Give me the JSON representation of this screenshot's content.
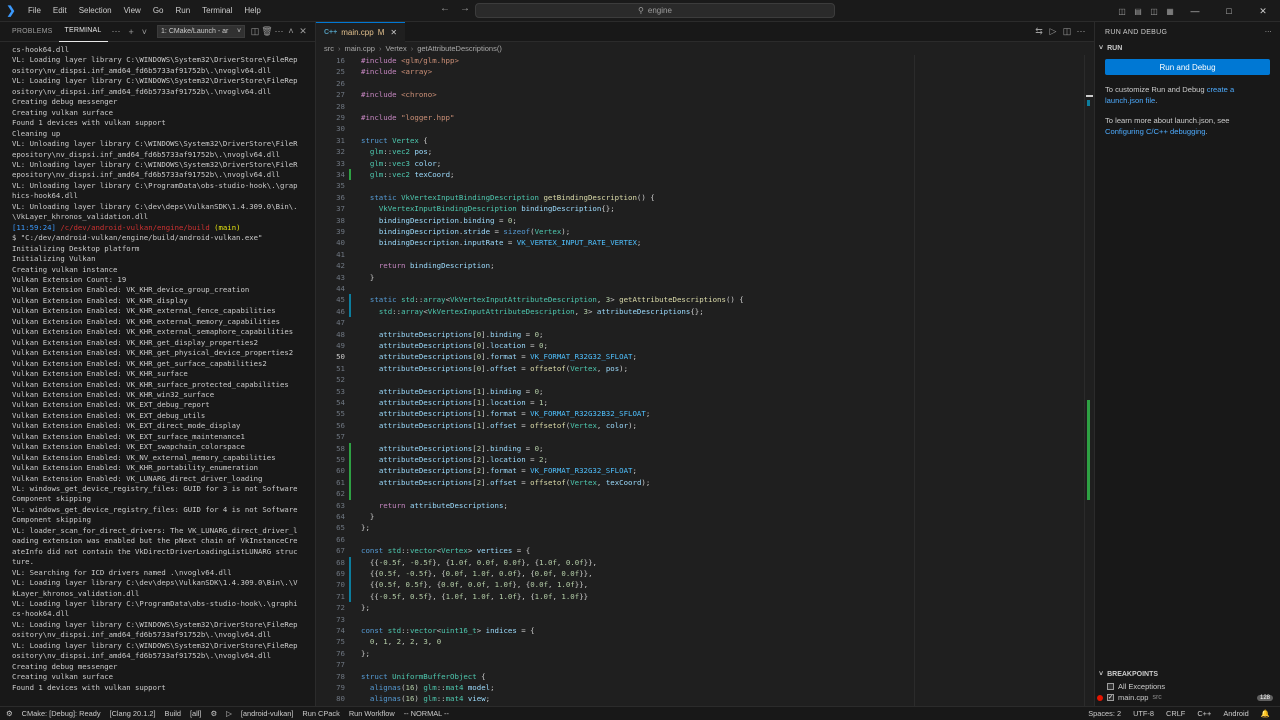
{
  "titlebar": {
    "menu": [
      "File",
      "Edit",
      "Selection",
      "View",
      "Go",
      "Run",
      "Terminal",
      "Help"
    ],
    "search_text": "engine",
    "icons": [
      "vscode-logo",
      "back-arrow",
      "forward-arrow",
      "search-icon",
      "toggle-primary-sidebar",
      "toggle-panel",
      "toggle-secondary-sidebar",
      "customize-layout",
      "minimize",
      "maximize",
      "close"
    ]
  },
  "panel": {
    "tab_problems": "PROBLEMS",
    "tab_terminal": "TERMINAL",
    "terminal_select": "1: CMake/Launch - ar",
    "lines": [
      "cs-hook64.dll",
      "VL: Loading layer library C:\\WINDOWS\\System32\\DriverStore\\FileRep",
      "ository\\nv_dispsi.inf_amd64_fd6b5733af91752b\\.\\nvoglv64.dll",
      "VL: Loading layer library C:\\WINDOWS\\System32\\DriverStore\\FileRep",
      "ository\\nv_dispsi.inf_amd64_fd6b5733af91752b\\.\\nvoglv64.dll",
      "Creating debug messenger",
      "Creating vulkan surface",
      "Found 1 devices with vulkan support",
      "Cleaning up",
      "VL: Unloading layer library C:\\WINDOWS\\System32\\DriverStore\\FileR",
      "epository\\nv_dispsi.inf_amd64_fd6b5733af91752b\\.\\nvoglv64.dll",
      "VL: Unloading layer library C:\\WINDOWS\\System32\\DriverStore\\FileR",
      "epository\\nv_dispsi.inf_amd64_fd6b5733af91752b\\.\\nvoglv64.dll",
      "VL: Unloading layer library C:\\ProgramData\\obs-studio-hook\\.\\grap",
      "hics-hook64.dll",
      "VL: Unloading layer library C:\\dev\\deps\\VulkanSDK\\1.4.309.0\\Bin\\.",
      "\\VkLayer_khronos_validation.dll"
    ],
    "prompt_time": "[11:59:24]",
    "prompt_path": "/c/dev/android-vulkan/engine/build",
    "prompt_branch": "(main)",
    "lines_after": [
      "$ \"C:/dev/android-vulkan/engine/build/android-vulkan.exe\"",
      "Initializing Desktop platform",
      "Initializing Vulkan",
      "Creating vulkan instance",
      "Vulkan Extension Count: 19",
      "Vulkan Extension Enabled: VK_KHR_device_group_creation",
      "Vulkan Extension Enabled: VK_KHR_display",
      "Vulkan Extension Enabled: VK_KHR_external_fence_capabilities",
      "Vulkan Extension Enabled: VK_KHR_external_memory_capabilities",
      "Vulkan Extension Enabled: VK_KHR_external_semaphore_capabilities",
      "Vulkan Extension Enabled: VK_KHR_get_display_properties2",
      "Vulkan Extension Enabled: VK_KHR_get_physical_device_properties2",
      "Vulkan Extension Enabled: VK_KHR_get_surface_capabilities2",
      "Vulkan Extension Enabled: VK_KHR_surface",
      "Vulkan Extension Enabled: VK_KHR_surface_protected_capabilities",
      "Vulkan Extension Enabled: VK_KHR_win32_surface",
      "Vulkan Extension Enabled: VK_EXT_debug_report",
      "Vulkan Extension Enabled: VK_EXT_debug_utils",
      "Vulkan Extension Enabled: VK_EXT_direct_mode_display",
      "Vulkan Extension Enabled: VK_EXT_surface_maintenance1",
      "Vulkan Extension Enabled: VK_EXT_swapchain_colorspace",
      "Vulkan Extension Enabled: VK_NV_external_memory_capabilities",
      "Vulkan Extension Enabled: VK_KHR_portability_enumeration",
      "Vulkan Extension Enabled: VK_LUNARG_direct_driver_loading",
      "VL: windows_get_device_registry_files: GUID for 3 is not Software",
      "Component skipping",
      "VL: windows_get_device_registry_files: GUID for 4 is not Software",
      "Component skipping",
      "VL: loader_scan_for_direct_drivers: The VK_LUNARG_direct_driver_l",
      "oading extension was enabled but the pNext chain of VkInstanceCre",
      "ateInfo did not contain the VkDirectDriverLoadingListLUNARG struc",
      "ture.",
      "VL: Searching for ICD drivers named .\\nvoglv64.dll",
      "VL: Loading layer library C:\\dev\\deps\\VulkanSDK\\1.4.309.0\\Bin\\.\\V",
      "kLayer_khronos_validation.dll",
      "VL: Loading layer library C:\\ProgramData\\obs-studio-hook\\.\\graphi",
      "cs-hook64.dll",
      "VL: Loading layer library C:\\WINDOWS\\System32\\DriverStore\\FileRep",
      "ository\\nv_dispsi.inf_amd64_fd6b5733af91752b\\.\\nvoglv64.dll",
      "VL: Loading layer library C:\\WINDOWS\\System32\\DriverStore\\FileRep",
      "ository\\nv_dispsi.inf_amd64_fd6b5733af91752b\\.\\nvoglv64.dll",
      "Creating debug messenger",
      "Creating vulkan surface",
      "Found 1 devices with vulkan support",
      ""
    ]
  },
  "editor": {
    "tab_lang": "C++",
    "tab_name": "main.cpp",
    "tab_state": "M",
    "breadcrumb": [
      "src",
      "main.cpp",
      "Vertex",
      "getAttributeDescriptions()"
    ],
    "current_line": "50",
    "lines": [
      {
        "n": "16",
        "g": "",
        "h": "<span class='pp'>#include</span> <span class='st'>&lt;glm/glm.hpp&gt;</span>"
      },
      {
        "n": "25",
        "g": "",
        "h": "<span class='pp'>#include</span> <span class='st'>&lt;array&gt;</span>"
      },
      {
        "n": "26",
        "g": "",
        "h": ""
      },
      {
        "n": "27",
        "g": "",
        "h": "<span class='pp'>#include</span> <span class='st'>&lt;chrono&gt;</span>"
      },
      {
        "n": "28",
        "g": "",
        "h": ""
      },
      {
        "n": "29",
        "g": "",
        "h": "<span class='pp'>#include</span> <span class='st'>\"logger.hpp\"</span>"
      },
      {
        "n": "30",
        "g": "",
        "h": ""
      },
      {
        "n": "31",
        "g": "",
        "h": "<span class='kw'>struct</span> <span class='ty'>Vertex</span> {"
      },
      {
        "n": "32",
        "g": "",
        "h": "  <span class='ty'>glm</span>::<span class='ty'>vec2</span> <span class='vr'>pos</span>;"
      },
      {
        "n": "33",
        "g": "",
        "h": "  <span class='ty'>glm</span>::<span class='ty'>vec3</span> <span class='vr'>color</span>;"
      },
      {
        "n": "34",
        "g": "add",
        "h": "  <span class='ty'>glm</span>::<span class='ty'>vec2</span> <span class='vr'>texCoord</span>;"
      },
      {
        "n": "35",
        "g": "",
        "h": ""
      },
      {
        "n": "36",
        "g": "",
        "h": "  <span class='kw'>static</span> <span class='ty'>VkVertexInputBindingDescription</span> <span class='fn'>getBindingDescription</span>() {"
      },
      {
        "n": "37",
        "g": "",
        "h": "    <span class='ty'>VkVertexInputBindingDescription</span> <span class='vr'>bindingDescription</span>{};"
      },
      {
        "n": "38",
        "g": "",
        "h": "    <span class='vr'>bindingDescription</span>.<span class='vr'>binding</span> = <span class='nu'>0</span>;"
      },
      {
        "n": "39",
        "g": "",
        "h": "    <span class='vr'>bindingDescription</span>.<span class='vr'>stride</span> = <span class='kw'>sizeof</span>(<span class='ty'>Vertex</span>);"
      },
      {
        "n": "40",
        "g": "",
        "h": "    <span class='vr'>bindingDescription</span>.<span class='vr'>inputRate</span> = <span class='en'>VK_VERTEX_INPUT_RATE_VERTEX</span>;"
      },
      {
        "n": "41",
        "g": "",
        "h": ""
      },
      {
        "n": "42",
        "g": "",
        "h": "    <span class='pp'>return</span> <span class='vr'>bindingDescription</span>;"
      },
      {
        "n": "43",
        "g": "",
        "h": "  }"
      },
      {
        "n": "44",
        "g": "",
        "h": ""
      },
      {
        "n": "45",
        "g": "mod",
        "h": "  <span class='kw'>static</span> <span class='ty'>std</span>::<span class='ty'>array</span>&lt;<span class='ty'>VkVertexInputAttributeDescription</span>, <span class='nu'>3</span>&gt; <span class='fn'>getAttributeDescriptions</span>() {"
      },
      {
        "n": "46",
        "g": "mod",
        "h": "    <span class='ty'>std</span>::<span class='ty'>array</span>&lt;<span class='ty'>VkVertexInputAttributeDescription</span>, <span class='nu'>3</span>&gt; <span class='vr'>attributeDescriptions</span>{};"
      },
      {
        "n": "47",
        "g": "",
        "h": ""
      },
      {
        "n": "48",
        "g": "",
        "h": "    <span class='vr'>attributeDescriptions</span>[<span class='nu'>0</span>].<span class='vr'>binding</span> = <span class='nu'>0</span>;"
      },
      {
        "n": "49",
        "g": "",
        "h": "    <span class='vr'>attributeDescriptions</span>[<span class='nu'>0</span>].<span class='vr'>location</span> = <span class='nu'>0</span>;"
      },
      {
        "n": "50",
        "g": "",
        "h": "    <span class='vr'>attributeDescriptions</span>[<span class='nu'>0</span>].<span class='vr'>format</span> = <span class='en'>VK_FORMAT_R32G32_SFLOAT</span>;"
      },
      {
        "n": "51",
        "g": "",
        "h": "    <span class='vr'>attributeDescriptions</span>[<span class='nu'>0</span>].<span class='vr'>offset</span> = <span class='fn'>offsetof</span>(<span class='ty'>Vertex</span>, <span class='vr'>pos</span>);"
      },
      {
        "n": "52",
        "g": "",
        "h": ""
      },
      {
        "n": "53",
        "g": "",
        "h": "    <span class='vr'>attributeDescriptions</span>[<span class='nu'>1</span>].<span class='vr'>binding</span> = <span class='nu'>0</span>;"
      },
      {
        "n": "54",
        "g": "",
        "h": "    <span class='vr'>attributeDescriptions</span>[<span class='nu'>1</span>].<span class='vr'>location</span> = <span class='nu'>1</span>;"
      },
      {
        "n": "55",
        "g": "",
        "h": "    <span class='vr'>attributeDescriptions</span>[<span class='nu'>1</span>].<span class='vr'>format</span> = <span class='en'>VK_FORMAT_R32G32B32_SFLOAT</span>;"
      },
      {
        "n": "56",
        "g": "",
        "h": "    <span class='vr'>attributeDescriptions</span>[<span class='nu'>1</span>].<span class='vr'>offset</span> = <span class='fn'>offsetof</span>(<span class='ty'>Vertex</span>, <span class='vr'>color</span>);"
      },
      {
        "n": "57",
        "g": "",
        "h": ""
      },
      {
        "n": "58",
        "g": "add",
        "h": "    <span class='vr'>attributeDescriptions</span>[<span class='nu'>2</span>].<span class='vr'>binding</span> = <span class='nu'>0</span>;"
      },
      {
        "n": "59",
        "g": "add",
        "h": "    <span class='vr'>attributeDescriptions</span>[<span class='nu'>2</span>].<span class='vr'>location</span> = <span class='nu'>2</span>;"
      },
      {
        "n": "60",
        "g": "add",
        "h": "    <span class='vr'>attributeDescriptions</span>[<span class='nu'>2</span>].<span class='vr'>format</span> = <span class='en'>VK_FORMAT_R32G32_SFLOAT</span>;"
      },
      {
        "n": "61",
        "g": "add",
        "h": "    <span class='vr'>attributeDescriptions</span>[<span class='nu'>2</span>].<span class='vr'>offset</span> = <span class='fn'>offsetof</span>(<span class='ty'>Vertex</span>, <span class='vr'>texCoord</span>);"
      },
      {
        "n": "62",
        "g": "add",
        "h": ""
      },
      {
        "n": "63",
        "g": "",
        "h": "    <span class='pp'>return</span> <span class='vr'>attributeDescriptions</span>;"
      },
      {
        "n": "64",
        "g": "",
        "h": "  }"
      },
      {
        "n": "65",
        "g": "",
        "h": "};"
      },
      {
        "n": "66",
        "g": "",
        "h": ""
      },
      {
        "n": "67",
        "g": "",
        "h": "<span class='kw'>const</span> <span class='ty'>std</span>::<span class='ty'>vector</span>&lt;<span class='ty'>Vertex</span>&gt; <span class='vr'>vertices</span> = {"
      },
      {
        "n": "68",
        "g": "mod",
        "h": "  {{<span class='nu'>-0.5f</span>, <span class='nu'>-0.5f</span>}, {<span class='nu'>1.0f</span>, <span class='nu'>0.0f</span>, <span class='nu'>0.0f</span>}, {<span class='nu'>1.0f</span>, <span class='nu'>0.0f</span>}},"
      },
      {
        "n": "69",
        "g": "mod",
        "h": "  {{<span class='nu'>0.5f</span>, <span class='nu'>-0.5f</span>}, {<span class='nu'>0.0f</span>, <span class='nu'>1.0f</span>, <span class='nu'>0.0f</span>}, {<span class='nu'>0.0f</span>, <span class='nu'>0.0f</span>}},"
      },
      {
        "n": "70",
        "g": "mod",
        "h": "  {{<span class='nu'>0.5f</span>, <span class='nu'>0.5f</span>}, {<span class='nu'>0.0f</span>, <span class='nu'>0.0f</span>, <span class='nu'>1.0f</span>}, {<span class='nu'>0.0f</span>, <span class='nu'>1.0f</span>}},"
      },
      {
        "n": "71",
        "g": "mod",
        "h": "  {{<span class='nu'>-0.5f</span>, <span class='nu'>0.5f</span>}, {<span class='nu'>1.0f</span>, <span class='nu'>1.0f</span>, <span class='nu'>1.0f</span>}, {<span class='nu'>1.0f</span>, <span class='nu'>1.0f</span>}}"
      },
      {
        "n": "72",
        "g": "",
        "h": "};"
      },
      {
        "n": "73",
        "g": "",
        "h": ""
      },
      {
        "n": "74",
        "g": "",
        "h": "<span class='kw'>const</span> <span class='ty'>std</span>::<span class='ty'>vector</span>&lt;<span class='ty'>uint16_t</span>&gt; <span class='vr'>indices</span> = {"
      },
      {
        "n": "75",
        "g": "",
        "h": "  <span class='nu'>0</span>, <span class='nu'>1</span>, <span class='nu'>2</span>, <span class='nu'>2</span>, <span class='nu'>3</span>, <span class='nu'>0</span>"
      },
      {
        "n": "76",
        "g": "",
        "h": "};"
      },
      {
        "n": "77",
        "g": "",
        "h": ""
      },
      {
        "n": "78",
        "g": "",
        "h": "<span class='kw'>struct</span> <span class='ty'>UniformBufferObject</span> {"
      },
      {
        "n": "79",
        "g": "",
        "h": "  <span class='kw'>alignas</span>(<span class='nu'>16</span>) <span class='ty'>glm</span>::<span class='ty'>mat4</span> <span class='vr'>model</span>;"
      },
      {
        "n": "80",
        "g": "",
        "h": "  <span class='kw'>alignas</span>(<span class='nu'>16</span>) <span class='ty'>glm</span>::<span class='ty'>mat4</span> <span class='vr'>view</span>;"
      }
    ]
  },
  "run_debug": {
    "header": "RUN AND DEBUG",
    "section": "RUN",
    "button": "Run and Debug",
    "text1": "To customize Run and Debug ",
    "link1": "create a launch.json file",
    "text1_end": ".",
    "text2": "To learn more about launch.json, see ",
    "link2": "Configuring C/C++ debugging",
    "text2_end": ".",
    "breakpoints_header": "BREAKPOINTS",
    "bp_all_exceptions": "All Exceptions",
    "bp_file": "main.cpp",
    "bp_dir": "src",
    "bp_line": "128"
  },
  "statusbar": {
    "cmake": "CMake: [Debug]: Ready",
    "compiler": "[Clang 20.1.2]",
    "build": "Build",
    "target": "[all]",
    "launch": "[android-vulkan]",
    "run_cpack": "Run CPack",
    "run_workflow": "Run Workflow",
    "vim_mode": "-- NORMAL --",
    "spaces": "Spaces: 2",
    "encoding": "UTF-8",
    "eol": "CRLF",
    "language": "C++",
    "platform": "Android"
  }
}
